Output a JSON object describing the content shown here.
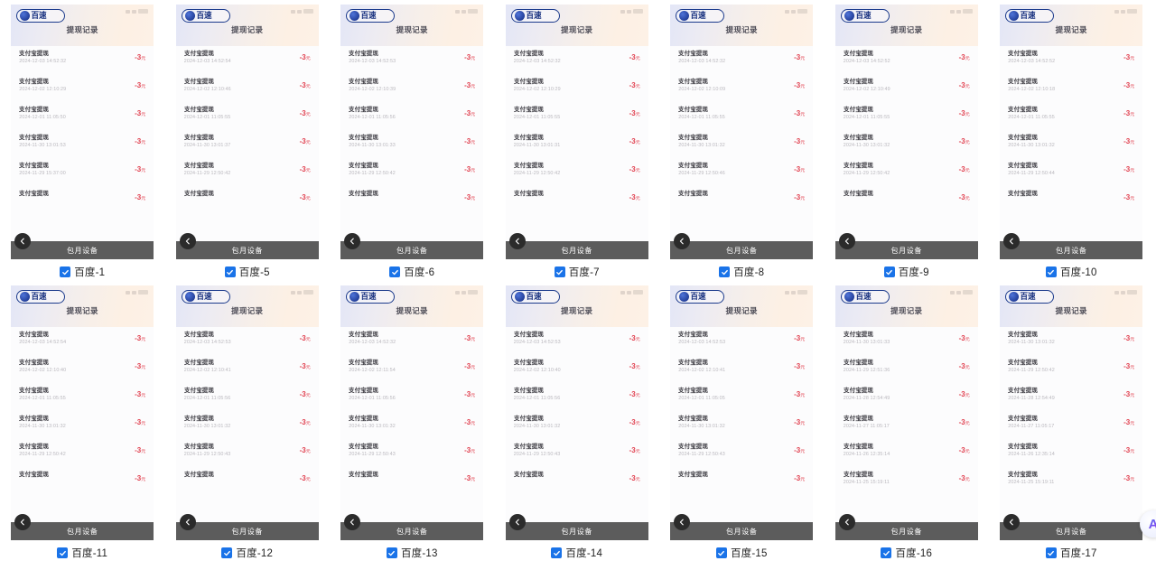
{
  "page": {
    "background": "#ffffff",
    "accent_blue": "#1a73e8",
    "amount_red": "#e1404f",
    "footer_gray": "#5c5c5c"
  },
  "phone": {
    "logo_text": "百速",
    "logo_icon": "baidu-paw-logo-icon",
    "title": "提现记录",
    "footer_label": "包月设备",
    "back_icon": "chevron-left-icon",
    "row_title": "支付宝提现",
    "amount_value": "-3",
    "amount_unit": "元"
  },
  "fab": {
    "icon": "ai-assistant-icon",
    "glyph": "A"
  },
  "checkbox": {
    "icon": "checkmark-icon",
    "checked": true
  },
  "cards": [
    {
      "label": "百度-1",
      "rows": [
        {
          "title": "支付宝提现",
          "date": "2024-12-03  14:52:32",
          "amount": "-3",
          "unit": "元"
        },
        {
          "title": "支付宝提现",
          "date": "2024-12-02  12:10:29",
          "amount": "-3",
          "unit": "元"
        },
        {
          "title": "支付宝提现",
          "date": "2024-12-01  11:05:50",
          "amount": "-3",
          "unit": "元"
        },
        {
          "title": "支付宝提现",
          "date": "2024-11-30  13:01:53",
          "amount": "-3",
          "unit": "元"
        },
        {
          "title": "支付宝提现",
          "date": "2024-11-29  15:37:00",
          "amount": "-3",
          "unit": "元"
        },
        {
          "title": "支付宝提现",
          "date": "",
          "amount": "-3",
          "unit": "元"
        }
      ]
    },
    {
      "label": "百度-5",
      "rows": [
        {
          "title": "支付宝提现",
          "date": "2024-12-03  14:52:54",
          "amount": "-3",
          "unit": "元"
        },
        {
          "title": "支付宝提现",
          "date": "2024-12-02  12:10:46",
          "amount": "-3",
          "unit": "元"
        },
        {
          "title": "支付宝提现",
          "date": "2024-12-01  11:05:55",
          "amount": "-3",
          "unit": "元"
        },
        {
          "title": "支付宝提现",
          "date": "2024-11-30  13:01:37",
          "amount": "-3",
          "unit": "元"
        },
        {
          "title": "支付宝提现",
          "date": "2024-11-29  12:50:42",
          "amount": "-3",
          "unit": "元"
        },
        {
          "title": "支付宝提现",
          "date": "",
          "amount": "-3",
          "unit": "元"
        }
      ]
    },
    {
      "label": "百度-6",
      "rows": [
        {
          "title": "支付宝提现",
          "date": "2024-12-03  14:52:53",
          "amount": "-3",
          "unit": "元"
        },
        {
          "title": "支付宝提现",
          "date": "2024-12-02  12:10:39",
          "amount": "-3",
          "unit": "元"
        },
        {
          "title": "支付宝提现",
          "date": "2024-12-01  11:05:56",
          "amount": "-3",
          "unit": "元"
        },
        {
          "title": "支付宝提现",
          "date": "2024-11-30  13:01:33",
          "amount": "-3",
          "unit": "元"
        },
        {
          "title": "支付宝提现",
          "date": "2024-11-29  12:50:42",
          "amount": "-3",
          "unit": "元"
        },
        {
          "title": "支付宝提现",
          "date": "",
          "amount": "-3",
          "unit": "元"
        }
      ]
    },
    {
      "label": "百度-7",
      "rows": [
        {
          "title": "支付宝提现",
          "date": "2024-12-03  14:52:32",
          "amount": "-3",
          "unit": "元"
        },
        {
          "title": "支付宝提现",
          "date": "2024-12-02  12:10:29",
          "amount": "-3",
          "unit": "元"
        },
        {
          "title": "支付宝提现",
          "date": "2024-12-01  11:05:55",
          "amount": "-3",
          "unit": "元"
        },
        {
          "title": "支付宝提现",
          "date": "2024-11-30  13:01:31",
          "amount": "-3",
          "unit": "元"
        },
        {
          "title": "支付宝提现",
          "date": "2024-11-29  12:50:42",
          "amount": "-3",
          "unit": "元"
        },
        {
          "title": "支付宝提现",
          "date": "",
          "amount": "-3",
          "unit": "元"
        }
      ]
    },
    {
      "label": "百度-8",
      "rows": [
        {
          "title": "支付宝提现",
          "date": "2024-12-03  14:52:32",
          "amount": "-3",
          "unit": "元"
        },
        {
          "title": "支付宝提现",
          "date": "2024-12-02  12:10:09",
          "amount": "-3",
          "unit": "元"
        },
        {
          "title": "支付宝提现",
          "date": "2024-12-01  11:05:55",
          "amount": "-3",
          "unit": "元"
        },
        {
          "title": "支付宝提现",
          "date": "2024-11-30  13:01:32",
          "amount": "-3",
          "unit": "元"
        },
        {
          "title": "支付宝提现",
          "date": "2024-11-29  12:50:46",
          "amount": "-3",
          "unit": "元"
        },
        {
          "title": "支付宝提现",
          "date": "",
          "amount": "-3",
          "unit": "元"
        }
      ]
    },
    {
      "label": "百度-9",
      "rows": [
        {
          "title": "支付宝提现",
          "date": "2024-12-03  14:52:52",
          "amount": "-3",
          "unit": "元"
        },
        {
          "title": "支付宝提现",
          "date": "2024-12-02  12:10:49",
          "amount": "-3",
          "unit": "元"
        },
        {
          "title": "支付宝提现",
          "date": "2024-12-01  11:05:55",
          "amount": "-3",
          "unit": "元"
        },
        {
          "title": "支付宝提现",
          "date": "2024-11-30  13:01:32",
          "amount": "-3",
          "unit": "元"
        },
        {
          "title": "支付宝提现",
          "date": "2024-11-29  12:50:42",
          "amount": "-3",
          "unit": "元"
        },
        {
          "title": "支付宝提现",
          "date": "",
          "amount": "-3",
          "unit": "元"
        }
      ]
    },
    {
      "label": "百度-10",
      "rows": [
        {
          "title": "支付宝提现",
          "date": "2024-12-03  14:52:52",
          "amount": "-3",
          "unit": "元"
        },
        {
          "title": "支付宝提现",
          "date": "2024-12-02  12:10:18",
          "amount": "-3",
          "unit": "元"
        },
        {
          "title": "支付宝提现",
          "date": "2024-12-01  11:05:55",
          "amount": "-3",
          "unit": "元"
        },
        {
          "title": "支付宝提现",
          "date": "2024-11-30  13:01:32",
          "amount": "-3",
          "unit": "元"
        },
        {
          "title": "支付宝提现",
          "date": "2024-11-29  12:50:44",
          "amount": "-3",
          "unit": "元"
        },
        {
          "title": "支付宝提现",
          "date": "",
          "amount": "-3",
          "unit": "元"
        }
      ]
    },
    {
      "label": "百度-11",
      "rows": [
        {
          "title": "支付宝提现",
          "date": "2024-12-03  14:52:54",
          "amount": "-3",
          "unit": "元"
        },
        {
          "title": "支付宝提现",
          "date": "2024-12-02  12:10:40",
          "amount": "-3",
          "unit": "元"
        },
        {
          "title": "支付宝提现",
          "date": "2024-12-01  11:05:55",
          "amount": "-3",
          "unit": "元"
        },
        {
          "title": "支付宝提现",
          "date": "2024-11-30  13:01:32",
          "amount": "-3",
          "unit": "元"
        },
        {
          "title": "支付宝提现",
          "date": "2024-11-29  12:50:42",
          "amount": "-3",
          "unit": "元"
        },
        {
          "title": "支付宝提现",
          "date": "",
          "amount": "-3",
          "unit": "元"
        }
      ]
    },
    {
      "label": "百度-12",
      "rows": [
        {
          "title": "支付宝提现",
          "date": "2024-12-03  14:52:53",
          "amount": "-3",
          "unit": "元"
        },
        {
          "title": "支付宝提现",
          "date": "2024-12-02  12:10:41",
          "amount": "-3",
          "unit": "元"
        },
        {
          "title": "支付宝提现",
          "date": "2024-12-01  11:05:56",
          "amount": "-3",
          "unit": "元"
        },
        {
          "title": "支付宝提现",
          "date": "2024-11-30  13:01:32",
          "amount": "-3",
          "unit": "元"
        },
        {
          "title": "支付宝提现",
          "date": "2024-11-29  12:50:43",
          "amount": "-3",
          "unit": "元"
        },
        {
          "title": "支付宝提现",
          "date": "",
          "amount": "-3",
          "unit": "元"
        }
      ]
    },
    {
      "label": "百度-13",
      "rows": [
        {
          "title": "支付宝提现",
          "date": "2024-12-03  14:52:32",
          "amount": "-3",
          "unit": "元"
        },
        {
          "title": "支付宝提现",
          "date": "2024-12-02  12:11:54",
          "amount": "-3",
          "unit": "元"
        },
        {
          "title": "支付宝提现",
          "date": "2024-12-01  11:05:56",
          "amount": "-3",
          "unit": "元"
        },
        {
          "title": "支付宝提现",
          "date": "2024-11-30  13:01:32",
          "amount": "-3",
          "unit": "元"
        },
        {
          "title": "支付宝提现",
          "date": "2024-11-29  12:50:43",
          "amount": "-3",
          "unit": "元"
        },
        {
          "title": "支付宝提现",
          "date": "",
          "amount": "-3",
          "unit": "元"
        }
      ]
    },
    {
      "label": "百度-14",
      "rows": [
        {
          "title": "支付宝提现",
          "date": "2024-12-03  14:52:53",
          "amount": "-3",
          "unit": "元"
        },
        {
          "title": "支付宝提现",
          "date": "2024-12-02  12:10:40",
          "amount": "-3",
          "unit": "元"
        },
        {
          "title": "支付宝提现",
          "date": "2024-12-01  11:05:56",
          "amount": "-3",
          "unit": "元"
        },
        {
          "title": "支付宝提现",
          "date": "2024-11-30  13:01:32",
          "amount": "-3",
          "unit": "元"
        },
        {
          "title": "支付宝提现",
          "date": "2024-11-29  12:50:43",
          "amount": "-3",
          "unit": "元"
        },
        {
          "title": "支付宝提现",
          "date": "",
          "amount": "-3",
          "unit": "元"
        }
      ]
    },
    {
      "label": "百度-15",
      "rows": [
        {
          "title": "支付宝提现",
          "date": "2024-12-03  14:52:53",
          "amount": "-3",
          "unit": "元"
        },
        {
          "title": "支付宝提现",
          "date": "2024-12-02  12:10:41",
          "amount": "-3",
          "unit": "元"
        },
        {
          "title": "支付宝提现",
          "date": "2024-12-01  11:05:05",
          "amount": "-3",
          "unit": "元"
        },
        {
          "title": "支付宝提现",
          "date": "2024-11-30  13:01:32",
          "amount": "-3",
          "unit": "元"
        },
        {
          "title": "支付宝提现",
          "date": "2024-11-29  12:50:43",
          "amount": "-3",
          "unit": "元"
        },
        {
          "title": "支付宝提现",
          "date": "",
          "amount": "-3",
          "unit": "元"
        }
      ]
    },
    {
      "label": "百度-16",
      "rows": [
        {
          "title": "支付宝提现",
          "date": "2024-11-30  13:01:33",
          "amount": "-3",
          "unit": "元"
        },
        {
          "title": "支付宝提现",
          "date": "2024-11-29  12:51:36",
          "amount": "-3",
          "unit": "元"
        },
        {
          "title": "支付宝提现",
          "date": "2024-11-28  12:54:49",
          "amount": "-3",
          "unit": "元"
        },
        {
          "title": "支付宝提现",
          "date": "2024-11-27  11:05:17",
          "amount": "-3",
          "unit": "元"
        },
        {
          "title": "支付宝提现",
          "date": "2024-11-26  12:35:14",
          "amount": "-3",
          "unit": "元"
        },
        {
          "title": "支付宝提现",
          "date": "2024-11-25  15:19:11",
          "amount": "-3",
          "unit": "元"
        }
      ]
    },
    {
      "label": "百度-17",
      "rows": [
        {
          "title": "支付宝提现",
          "date": "2024-11-30  13:01:32",
          "amount": "-3",
          "unit": "元"
        },
        {
          "title": "支付宝提现",
          "date": "2024-11-29  12:50:42",
          "amount": "-3",
          "unit": "元"
        },
        {
          "title": "支付宝提现",
          "date": "2024-11-28  12:54:49",
          "amount": "-3",
          "unit": "元"
        },
        {
          "title": "支付宝提现",
          "date": "2024-11-27  11:05:17",
          "amount": "-3",
          "unit": "元"
        },
        {
          "title": "支付宝提现",
          "date": "2024-11-26  12:35:14",
          "amount": "-3",
          "unit": "元"
        },
        {
          "title": "支付宝提现",
          "date": "2024-11-25  15:19:11",
          "amount": "-3",
          "unit": "元"
        }
      ]
    }
  ]
}
